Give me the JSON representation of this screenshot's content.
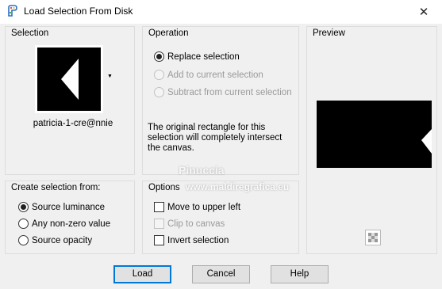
{
  "window": {
    "title": "Load Selection From Disk",
    "close_glyph": "✕",
    "app_icon": "paint-palette-icon"
  },
  "selection_group": {
    "title": "Selection",
    "file_name": "patricia-1-cre@nnie",
    "dropdown_glyph": "▼"
  },
  "operation_group": {
    "title": "Operation",
    "options": [
      {
        "label": "Replace selection",
        "checked": true,
        "disabled": false
      },
      {
        "label": "Add to current selection",
        "checked": false,
        "disabled": true
      },
      {
        "label": "Subtract from current selection",
        "checked": false,
        "disabled": true
      }
    ],
    "info": "The original rectangle for this selection will completely intersect the canvas."
  },
  "preview_group": {
    "title": "Preview",
    "checker_icon": "transparency-checker-icon"
  },
  "create_group": {
    "title": "Create selection from:",
    "options": [
      {
        "label": "Source luminance",
        "checked": true
      },
      {
        "label": "Any non-zero value",
        "checked": false
      },
      {
        "label": "Source opacity",
        "checked": false
      }
    ]
  },
  "options_group": {
    "title": "Options",
    "items": [
      {
        "label": "Move to upper left",
        "checked": false,
        "disabled": false
      },
      {
        "label": "Clip to canvas",
        "checked": false,
        "disabled": true
      },
      {
        "label": "Invert selection",
        "checked": false,
        "disabled": false
      }
    ]
  },
  "buttons": {
    "load": "Load",
    "cancel": "Cancel",
    "help": "Help"
  },
  "watermark": {
    "name": "Pinuccia",
    "site": "www.maldiregrafica.eu"
  }
}
